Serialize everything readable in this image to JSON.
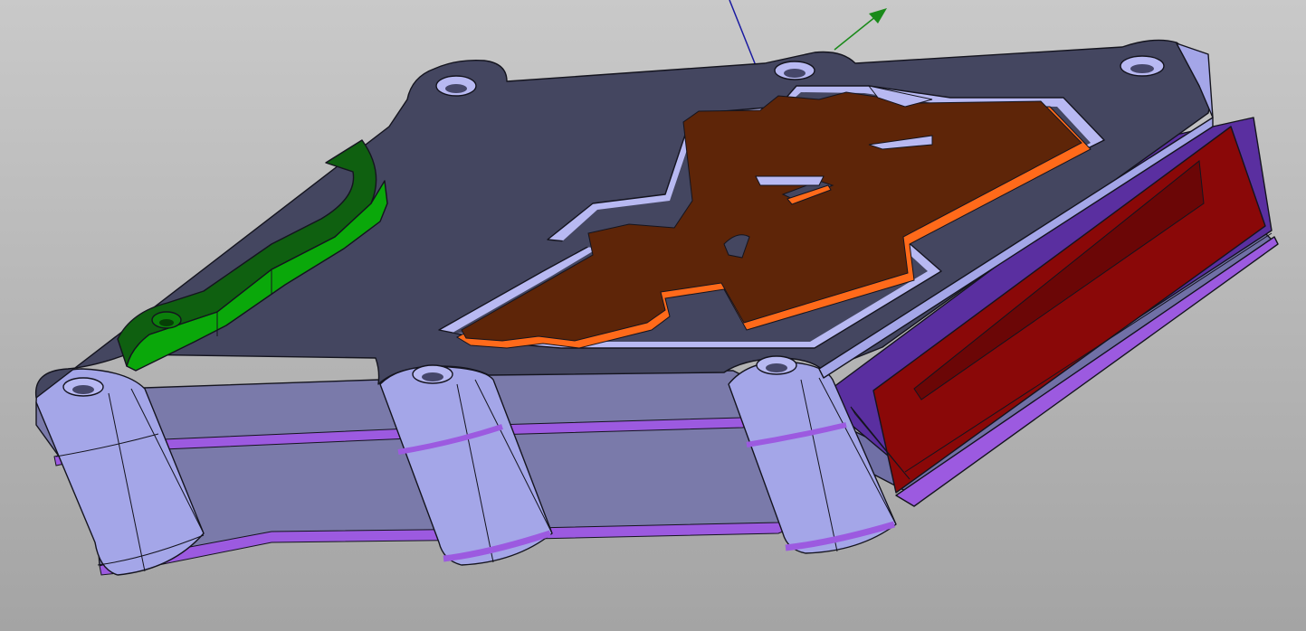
{
  "viewer": {
    "background_top": "#c9c9c9",
    "background_bottom": "#a4a4a4"
  },
  "model": {
    "colors": {
      "top_face": "#444660",
      "side_face": "#7a7aaa",
      "boss_face": "#a4a6e8",
      "seam_stripe": "#9c5ae0",
      "end_panel": "#8a0808",
      "end_panel_frame": "#5a2fa0",
      "logo_fill": "#5e2508",
      "logo_wall": "#ff6a1a",
      "pocket_wall": "#b8b9f2",
      "clip_top": "#0f6010",
      "clip_side": "#0aa80a"
    }
  },
  "axes": {
    "z_color": "#1a1aa0",
    "y_color": "#1a8a1a"
  }
}
